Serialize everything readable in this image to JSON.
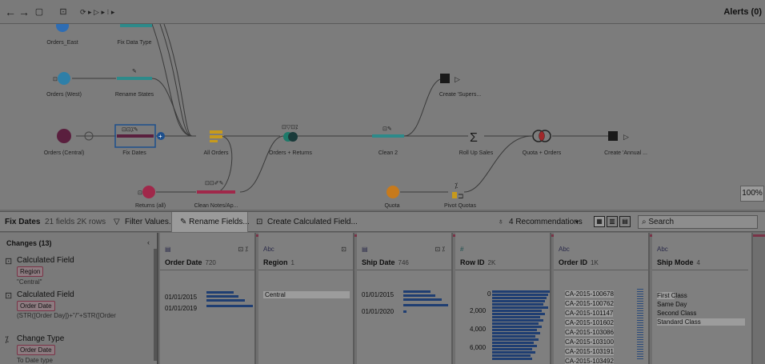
{
  "toolbar": {
    "back": "←",
    "forward": "→",
    "save": "▢",
    "connect": "⊡",
    "refresh": "⟳ ▸ ▷ ▸ ⁝ ▸",
    "alerts": "Alerts (0)"
  },
  "canvas": {
    "nodes": {
      "orders_east": "Orders_East",
      "fix_data_type": "Fix Data Type",
      "orders_west": "Orders (West)",
      "rename_states": "Rename States",
      "create_superstore": "Create 'Supers...",
      "orders_central": "Orders (Central)",
      "fix_dates": "Fix Dates",
      "all_orders": "All Orders",
      "orders_returns": "Orders + Returns",
      "clean2": "Clean 2",
      "roll_up_sales": "Roll Up Sales",
      "quota_orders": "Quota + Orders",
      "create_annual": "Create 'Annual ...",
      "returns_all": "Returns (all)",
      "clean_notes": "Clean Notes/Ap...",
      "quota": "Quota",
      "pivot_quotas": "Pivot Quotas"
    },
    "zoom": "100%"
  },
  "strip": {
    "step_name": "Fix Dates",
    "step_meta": "21 fields  2K rows",
    "filter_values": "Filter Values...",
    "rename_fields": "Rename Fields...",
    "create_calc": "Create Calculated Field...",
    "recommendations": "4 Recommendations",
    "search_placeholder": "Search"
  },
  "changes": {
    "title": "Changes (13)",
    "items": [
      {
        "type": "Calculated Field",
        "field": "Region",
        "detail": "\"Central\""
      },
      {
        "type": "Calculated Field",
        "field": "Order Date",
        "detail": "(STR([Order Day])+\"/\"+STR([Order"
      },
      {
        "type": "Change Type",
        "field": "Order Date",
        "detail": "To Date type"
      }
    ]
  },
  "columns": [
    {
      "type": "▤",
      "name": "Order Date",
      "count": "720",
      "values": [
        "01/01/2015",
        "01/01/2019"
      ]
    },
    {
      "type": "Abc",
      "name": "Region",
      "count": "1",
      "values": [
        "Central"
      ]
    },
    {
      "type": "▤",
      "name": "Ship Date",
      "count": "746",
      "values": [
        "01/01/2015",
        "01/01/2020"
      ]
    },
    {
      "type": "#",
      "name": "Row ID",
      "count": "2K",
      "values": [
        "0",
        "2,000",
        "4,000",
        "6,000"
      ]
    },
    {
      "type": "Abc",
      "name": "Order ID",
      "count": "1K",
      "values": [
        "CA-2015-100678",
        "CA-2015-100762",
        "CA-2015-101147",
        "CA-2015-101602",
        "CA-2015-103086",
        "CA-2015-103100",
        "CA-2015-103191",
        "CA-2015-103492"
      ]
    },
    {
      "type": "Abc",
      "name": "Ship Mode",
      "count": "4",
      "values": [
        "First Class",
        "Same Day",
        "Second Class",
        "Standard Class"
      ]
    }
  ],
  "colors": {
    "accent": "#7a3347",
    "bar": "#1f3e72",
    "highlight": "#2e6db4"
  }
}
